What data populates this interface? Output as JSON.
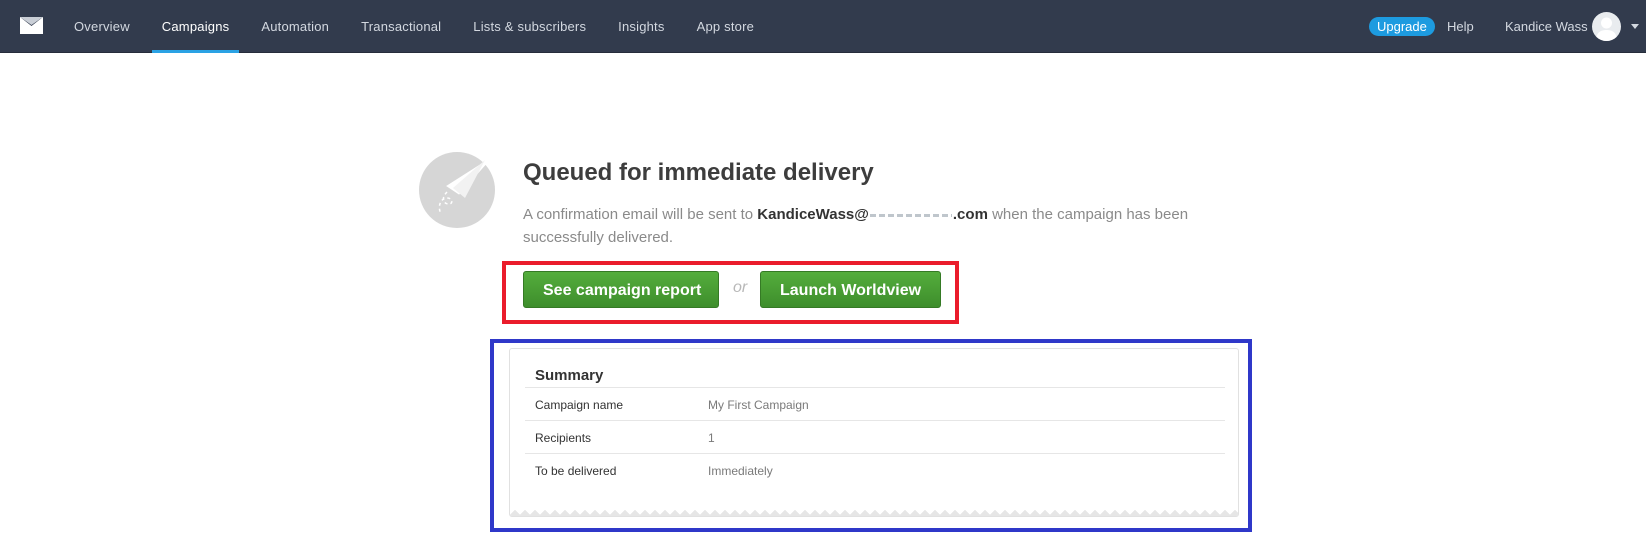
{
  "nav": {
    "items": [
      {
        "label": "Overview"
      },
      {
        "label": "Campaigns"
      },
      {
        "label": "Automation"
      },
      {
        "label": "Transactional"
      },
      {
        "label": "Lists & subscribers"
      },
      {
        "label": "Insights"
      },
      {
        "label": "App store"
      }
    ],
    "active": "Campaigns",
    "upgrade_label": "Upgrade",
    "help_label": "Help",
    "user_name": "Kandice Wass",
    "accent_color": "#2aa2e4",
    "bg_color": "#323b4d"
  },
  "main": {
    "title": "Queued for immediate delivery",
    "desc_prefix": "A confirmation email will be sent to ",
    "email_user": "KandiceWass@",
    "email_tail": ".com",
    "desc_suffix": " when the campaign has been successfully delivered.",
    "primary_button": "See campaign report",
    "or_text": "or",
    "secondary_button": "Launch Worldview",
    "button_color": "#47a034"
  },
  "summary": {
    "title": "Summary",
    "rows": [
      {
        "label": "Campaign name",
        "value": "My First Campaign"
      },
      {
        "label": "Recipients",
        "value": "1"
      },
      {
        "label": "To be delivered",
        "value": "Immediately"
      }
    ]
  },
  "highlights": {
    "actions_color": "#ea1c2b",
    "summary_color": "#2f38c9"
  }
}
